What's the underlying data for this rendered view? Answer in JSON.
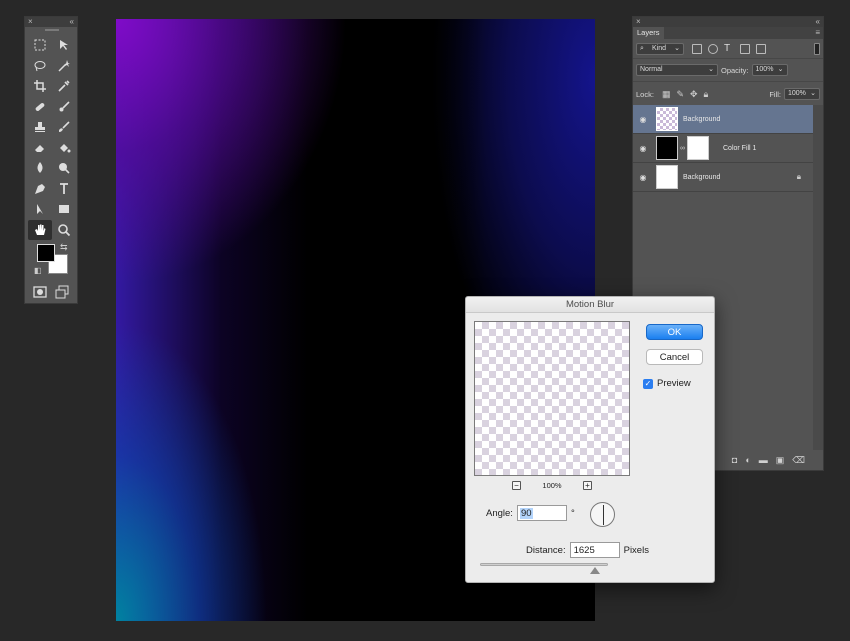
{
  "tools_panel": {
    "close": "×",
    "collapse": "«",
    "swap_glyph": "⇆",
    "reset_glyph": "◧"
  },
  "layers_panel": {
    "close": "×",
    "collapse": "«",
    "tab_label": "Layers",
    "menu_glyph": "≡",
    "filter_kind": "Kind",
    "blend_mode": "Normal",
    "opacity_label": "Opacity:",
    "opacity_value": "100%",
    "lock_label": "Lock:",
    "fill_label": "Fill:",
    "fill_value": "100%",
    "layers": [
      {
        "name": "Background",
        "selected": true
      },
      {
        "name": "Color Fill 1",
        "selected": false
      },
      {
        "name": "Background",
        "selected": false,
        "locked": true
      }
    ]
  },
  "dialog": {
    "title": "Motion Blur",
    "ok_label": "OK",
    "cancel_label": "Cancel",
    "preview_label": "Preview",
    "preview_checked": true,
    "zoom_level": "100%",
    "zoom_minus": "−",
    "zoom_plus": "+",
    "angle_label": "Angle:",
    "angle_value": "90",
    "angle_unit": "°",
    "distance_label": "Distance:",
    "distance_value": "1625",
    "distance_unit": "Pixels",
    "distance_slider_fraction": 0.9
  },
  "colors": {
    "foreground": "#000000",
    "background": "#ffffff",
    "ok_button": "#1a7ff0",
    "selected_layer": "#657590"
  }
}
